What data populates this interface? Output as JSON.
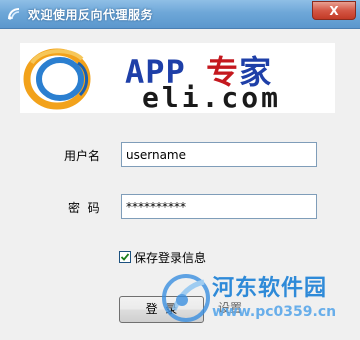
{
  "window": {
    "title": "欢迎使用反向代理服务",
    "close_label": "X"
  },
  "logo": {
    "brand_en": "APP",
    "brand_zh_1": "专",
    "brand_zh_2": "家",
    "domain": "eli.com"
  },
  "form": {
    "username_label": "用户名",
    "username_value": "username",
    "password_label": "密  码",
    "password_value": "**********",
    "remember_label": "保存登录信息",
    "remember_checked": true
  },
  "buttons": {
    "login_label": "登  录",
    "settings_label": "设置"
  },
  "watermark": {
    "site_name": "河东软件园",
    "url": "www.pc0359.cn"
  },
  "colors": {
    "titlebar": "#6ea7d8",
    "close_button": "#d45745",
    "brand_blue": "#1e3fa8",
    "brand_red": "#c4181e",
    "watermark_blue": "#1a7fd6"
  },
  "icons": {
    "title": "app-icon",
    "close": "close-icon",
    "logo": "orbit-logo-icon",
    "check": "check-icon",
    "watermark": "watermark-logo-icon"
  }
}
